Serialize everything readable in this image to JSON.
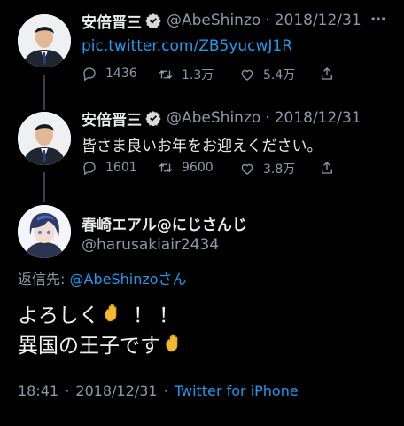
{
  "tweet1": {
    "name": "安倍晋三",
    "handle": "@AbeShinzo",
    "dot": "·",
    "date": "2018/12/31",
    "link": "pic.twitter.com/ZB5yucwJ1R",
    "replies": "1436",
    "retweets": "1.3万",
    "likes": "5.4万"
  },
  "tweet2": {
    "name": "安倍晋三",
    "handle": "@AbeShinzo",
    "dot": "·",
    "date": "2018/12/31",
    "text": "皆さま良いお年をお迎えください。",
    "replies": "1601",
    "retweets": "9600",
    "likes": "3.8万"
  },
  "main_tweet": {
    "name": "春崎エアル@にじさんじ",
    "handle": "@harusakiair2434",
    "reply_label": "返信先:",
    "reply_handle": "@AbeShinzoさん",
    "line1_text": "よろしく",
    "line1_suffix": "！！",
    "line2_text": "異国の王子です",
    "time": "18:41",
    "date": "2018/12/31",
    "dot": "·",
    "source": "Twitter for iPhone"
  },
  "colors": {
    "background": "#000000",
    "link": "#1d9bf0",
    "muted": "#8b98a5",
    "verified": "#d9d9d9"
  },
  "icons": [
    "verified-icon",
    "reply-icon",
    "retweet-icon",
    "like-icon",
    "share-icon",
    "more-icon",
    "waving-hand-icon"
  ]
}
